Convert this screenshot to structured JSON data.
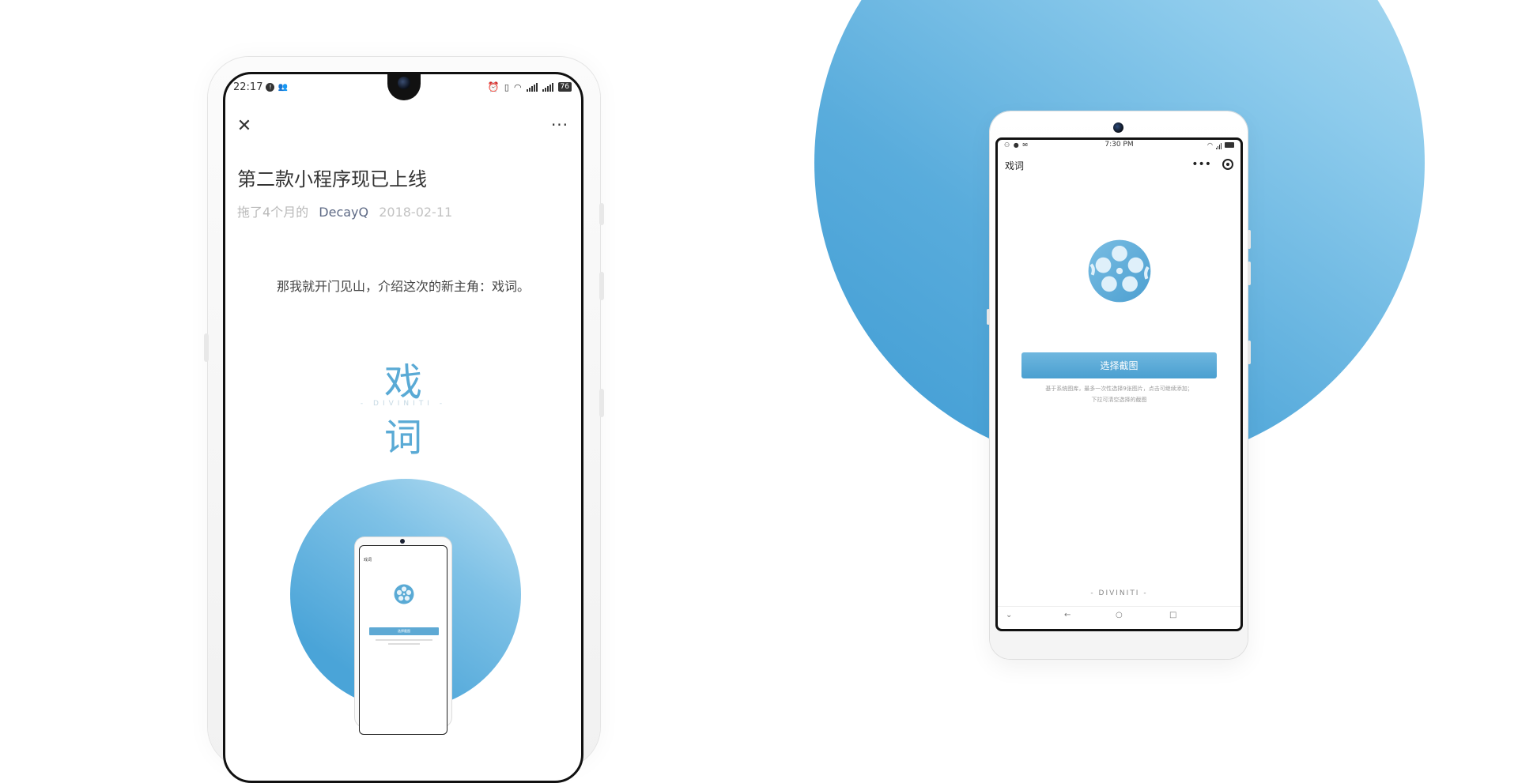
{
  "left_phone": {
    "status_bar": {
      "time": "22:17",
      "notif_badge": "!",
      "battery": "76",
      "icons": [
        "alarm-icon",
        "vibrate-icon",
        "wifi-icon",
        "signal-icon",
        "signal-icon",
        "battery-icon"
      ]
    },
    "nav": {
      "close_icon": "✕",
      "more_icon": "···"
    },
    "article": {
      "title": "第二款小程序现已上线",
      "meta_prefix": "拖了4个月的",
      "author": "DecayQ",
      "date": "2018-02-11",
      "body": "那我就开门见山，介绍这次的新主角：戏词。"
    },
    "logo": {
      "text": "戏词",
      "subtitle": "- DIVINITI -"
    },
    "mini_phone": {
      "title": "戏词",
      "button": "选择截图"
    }
  },
  "right_phone": {
    "status_bar": {
      "time": "7:30 PM"
    },
    "app_title": "戏词",
    "capsule": {
      "more": "•••"
    },
    "select_button": "选择截图",
    "hint_line1": "基于系统图库，最多一次性选择9张图片，点击可继续添加；",
    "hint_line2": "下拉可清空选择的截图",
    "footer_brand": "- DIVINITI -",
    "nav_keys": [
      "⌄",
      "←",
      "○",
      "□"
    ]
  },
  "colors": {
    "accent": "#4a9fd0",
    "circle_light": "#b6dff2",
    "circle_dark": "#3e9bd3"
  }
}
